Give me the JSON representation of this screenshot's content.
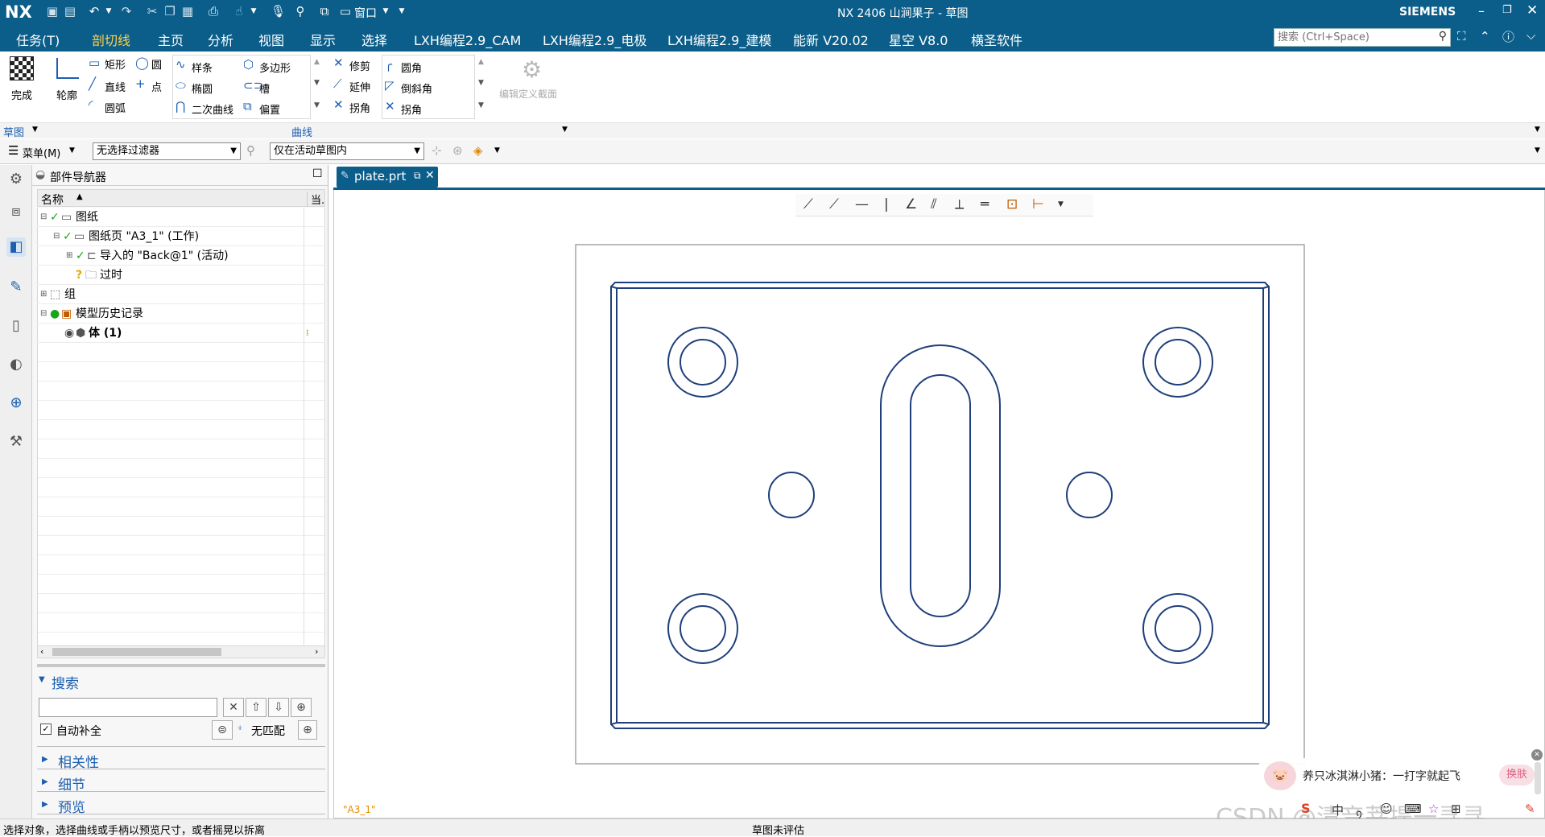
{
  "title": {
    "logo": "NX",
    "text": "NX 2406 山涧果子 - 草图",
    "window_label": "窗口",
    "brand": "SIEMENS"
  },
  "menu": {
    "items": [
      "任务(T)",
      "剖切线",
      "主页",
      "分析",
      "视图",
      "显示",
      "选择",
      "LXH编程2.9_CAM",
      "LXH编程2.9_电极",
      "LXH编程2.9_建模",
      "能新 V20.02",
      "星空 V8.0",
      "横圣软件"
    ],
    "active_index": 1,
    "search_placeholder": "搜索 (Ctrl+Space)"
  },
  "ribbon": {
    "finish": "完成",
    "profile": "轮廓",
    "col1": [
      "矩形",
      "直线",
      "圆弧"
    ],
    "col2": [
      "圆",
      "点"
    ],
    "col3": [
      "样条",
      "椭圆",
      "二次曲线"
    ],
    "col4": [
      "多边形",
      "槽",
      "偏置"
    ],
    "col5": [
      "修剪",
      "延伸",
      "拐角"
    ],
    "col6": [
      "圆角",
      "倒斜角",
      "拐角"
    ],
    "edit_section": "编辑定义截面",
    "group_sketch": "草图",
    "group_curve": "曲线"
  },
  "filterbar": {
    "menu_label": "菜单(M)",
    "filter_value": "无选择过滤器",
    "scope_value": "仅在活动草图内"
  },
  "navigator": {
    "title": "部件导航器",
    "col_name": "名称",
    "col_current": "当.",
    "tree": [
      {
        "label": "图纸",
        "indent": 0
      },
      {
        "label": "图纸页 \"A3_1\" (工作)",
        "indent": 1
      },
      {
        "label": "导入的 \"Back@1\" (活动)",
        "indent": 2
      },
      {
        "label": "过时",
        "indent": 2
      },
      {
        "label": "组",
        "indent": 0
      },
      {
        "label": "模型历史记录",
        "indent": 0
      },
      {
        "label": "体 (1)",
        "indent": 1
      }
    ],
    "search_section": "搜索",
    "search_value": "",
    "auto_complete": "自动补全",
    "no_match": "无匹配",
    "sections": [
      "相关性",
      "细节",
      "预览"
    ]
  },
  "graphics": {
    "tab_label": "plate.prt",
    "sheet_name": "\"A3_1\""
  },
  "ime": {
    "popup_text": "养只冰淇淋小猪：一打字就起飞",
    "skin_button": "换肤",
    "chars": [
      "中",
      "᠀",
      "☺",
      "⌨",
      "☆",
      "⊞"
    ]
  },
  "watermark": "CSDN @清音菩提一寻寻",
  "status": {
    "left": "选择对象，选择曲线或手柄以预览尺寸，或者摇晃以拆离",
    "center": "草图未评估"
  },
  "colors": {
    "title_bg": "#0b5e8a",
    "sketch_line": "#1f3f7a",
    "accent": "#1c5fb0",
    "active_tab": "#ffd24a"
  }
}
